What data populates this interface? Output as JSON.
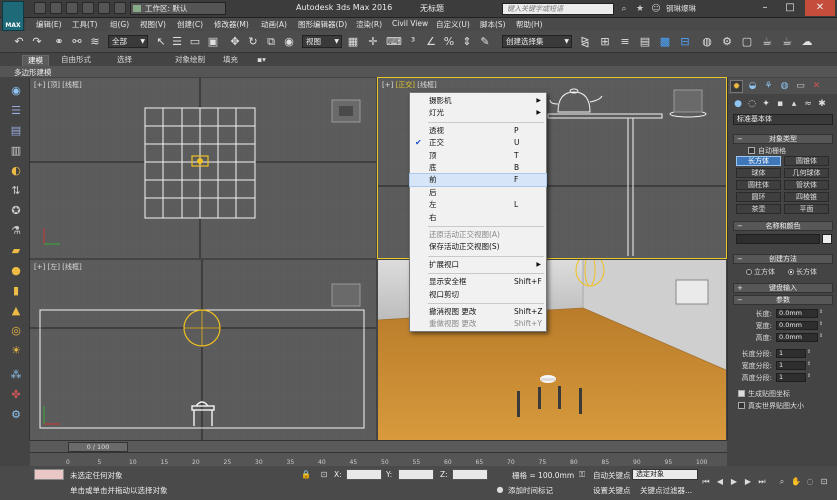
{
  "titlebar": {
    "logo_text": "MAX",
    "workspace_label": "工作区: 默认",
    "title": "Autodesk 3ds Max 2016",
    "doc_title": "无标题",
    "search_placeholder": "键入关键字或短语",
    "user_name": "钢琳爆琳"
  },
  "menubar": {
    "items": [
      "编辑(E)",
      "工具(T)",
      "组(G)",
      "视图(V)",
      "创建(C)",
      "修改器(M)",
      "动画(A)",
      "图形编辑器(D)",
      "渲染(R)",
      "Civil View",
      "自定义(U)",
      "脚本(S)",
      "帮助(H)"
    ]
  },
  "toolbar": {
    "filter_value": "全部",
    "refcoord_value": "视图",
    "selection_set": "创建选择集"
  },
  "ribbon": {
    "tabs": [
      "建模",
      "自由形式",
      "选择",
      "对象绘制",
      "填充"
    ],
    "sub_label": "多边形建模"
  },
  "viewports": {
    "top": {
      "label_a": "[+]",
      "label_b": "[顶]",
      "label_c": "[线框]"
    },
    "front": {
      "label_a": "[+]",
      "label_b": "[正交]",
      "label_c": "[线框]"
    },
    "left": {
      "label_a": "[+]",
      "label_b": "[左]",
      "label_c": "[线框]"
    }
  },
  "context_menu": {
    "items": [
      {
        "label": "摄影机",
        "shortcut": "",
        "submenu": true,
        "checked": false,
        "disabled": false
      },
      {
        "label": "灯光",
        "shortcut": "",
        "submenu": true,
        "checked": false,
        "disabled": false
      },
      {
        "sep": true
      },
      {
        "label": "透视",
        "shortcut": "P",
        "submenu": false,
        "checked": false,
        "disabled": false
      },
      {
        "label": "正交",
        "shortcut": "U",
        "submenu": false,
        "checked": true,
        "disabled": false
      },
      {
        "label": "顶",
        "shortcut": "T",
        "submenu": false,
        "checked": false,
        "disabled": false
      },
      {
        "label": "底",
        "shortcut": "B",
        "submenu": false,
        "checked": false,
        "disabled": false
      },
      {
        "label": "前",
        "shortcut": "F",
        "submenu": false,
        "checked": false,
        "disabled": false,
        "hover": true
      },
      {
        "label": "后",
        "shortcut": "",
        "submenu": false,
        "checked": false,
        "disabled": false
      },
      {
        "label": "左",
        "shortcut": "L",
        "submenu": false,
        "checked": false,
        "disabled": false
      },
      {
        "label": "右",
        "shortcut": "",
        "submenu": false,
        "checked": false,
        "disabled": false
      },
      {
        "sep": true
      },
      {
        "label": "还原活动正交视图(A)",
        "shortcut": "",
        "submenu": false,
        "checked": false,
        "disabled": true
      },
      {
        "label": "保存活动正交视图(S)",
        "shortcut": "",
        "submenu": false,
        "checked": false,
        "disabled": false
      },
      {
        "sep": true
      },
      {
        "label": "扩展视口",
        "shortcut": "",
        "submenu": true,
        "checked": false,
        "disabled": false
      },
      {
        "sep": true
      },
      {
        "label": "显示安全框",
        "shortcut": "Shift+F",
        "submenu": false,
        "checked": false,
        "disabled": false
      },
      {
        "label": "视口剪切",
        "shortcut": "",
        "submenu": false,
        "checked": false,
        "disabled": false
      },
      {
        "sep": true
      },
      {
        "label": "撤消视图 更改",
        "shortcut": "Shift+Z",
        "submenu": false,
        "checked": false,
        "disabled": false
      },
      {
        "label": "重做视图 更改",
        "shortcut": "Shift+Y",
        "submenu": false,
        "checked": false,
        "disabled": true
      }
    ]
  },
  "command_panel": {
    "category": "标准基本体",
    "object_type_title": "对象类型",
    "autogrid": "自动栅格",
    "objects": [
      "长方体",
      "圆锥体",
      "球体",
      "几何球体",
      "圆柱体",
      "管状体",
      "圆环",
      "四棱锥",
      "茶壶",
      "平面"
    ],
    "active_object": "长方体",
    "name_color_title": "名称和颜色",
    "create_method_title": "创建方法",
    "create_method_options": [
      "立方体",
      "长方体"
    ],
    "create_method_selected": "长方体",
    "keyboard_entry_title": "键盘输入",
    "params_title": "参数",
    "params": [
      {
        "label": "长度:",
        "value": "0.0mm"
      },
      {
        "label": "宽度:",
        "value": "0.0mm"
      },
      {
        "label": "高度:",
        "value": "0.0mm"
      }
    ],
    "segments": [
      {
        "label": "长度分段:",
        "value": "1"
      },
      {
        "label": "宽度分段:",
        "value": "1"
      },
      {
        "label": "高度分段:",
        "value": "1"
      }
    ],
    "gen_mapping": "生成贴图坐标",
    "real_world": "真实世界贴图大小"
  },
  "timeline": {
    "slider_label": "0 / 100",
    "ticks": [
      "0",
      "5",
      "10",
      "15",
      "20",
      "25",
      "30",
      "35",
      "40",
      "45",
      "50",
      "55",
      "60",
      "65",
      "70",
      "75",
      "80",
      "85",
      "90",
      "95",
      "100"
    ]
  },
  "statusbar": {
    "selection_status": "未选定任何对象",
    "prompt": "单击或单击并拖动以选择对象",
    "x_label": "X:",
    "y_label": "Y:",
    "z_label": "Z:",
    "grid_label": "栅格 = 100.0mm",
    "add_time_tag": "添加时间标记",
    "auto_key": "自动关键点",
    "selected_obj": "选定对象",
    "set_key": "设置关键点",
    "key_filters": "关键点过滤器..."
  }
}
